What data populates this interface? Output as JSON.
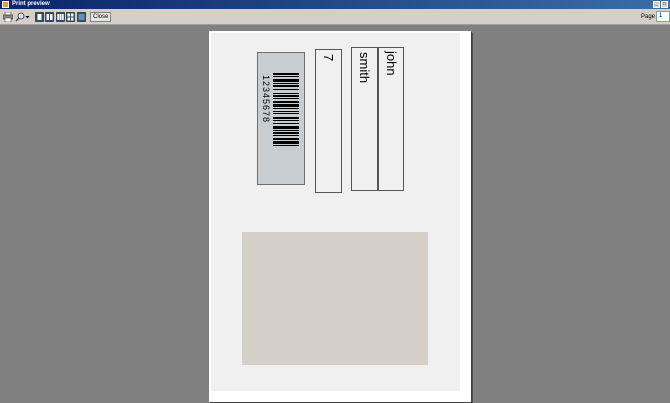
{
  "window": {
    "title": "Print preview"
  },
  "toolbar": {
    "close_label": "Close",
    "page_label": "Page",
    "page_value": "1"
  },
  "label": {
    "barcode_text": "12345678",
    "first_name": "john",
    "last_name": "smith",
    "number": "7"
  },
  "colors": {
    "titlebar": "#0a246a",
    "workspace": "#808080",
    "photo_placeholder": "#d4d0c8",
    "barcode_background": "#c8cdd2"
  }
}
